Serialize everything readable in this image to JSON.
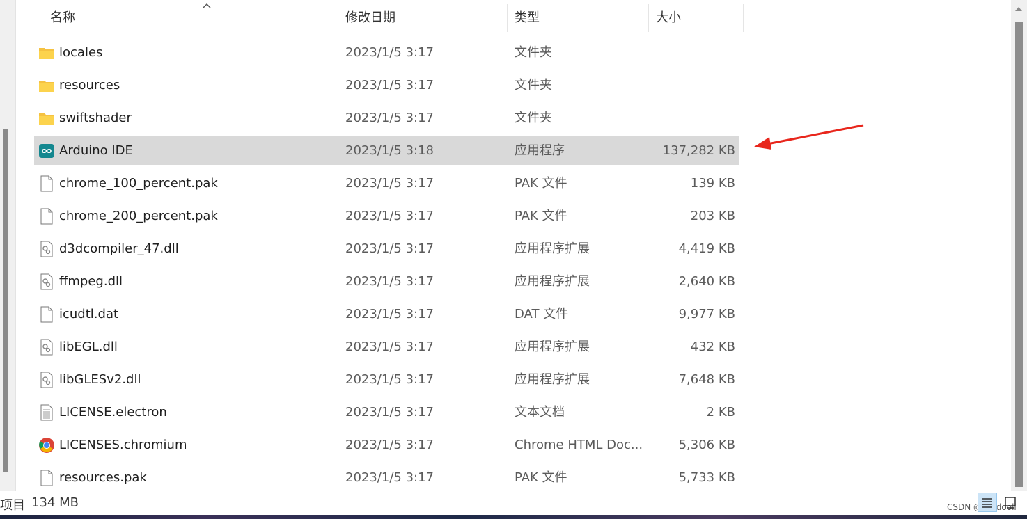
{
  "header": {
    "columns": {
      "name": "名称",
      "date": "修改日期",
      "type": "类型",
      "size": "大小"
    },
    "sort_indicator": "^"
  },
  "files": [
    {
      "icon": "folder-icon",
      "name": "locales",
      "date": "2023/1/5 3:17",
      "type": "文件夹",
      "size": ""
    },
    {
      "icon": "folder-icon",
      "name": "resources",
      "date": "2023/1/5 3:17",
      "type": "文件夹",
      "size": ""
    },
    {
      "icon": "folder-icon",
      "name": "swiftshader",
      "date": "2023/1/5 3:17",
      "type": "文件夹",
      "size": ""
    },
    {
      "icon": "arduino-icon",
      "name": "Arduino IDE",
      "date": "2023/1/5 3:18",
      "type": "应用程序",
      "size": "137,282 KB",
      "selected": true
    },
    {
      "icon": "file-icon",
      "name": "chrome_100_percent.pak",
      "date": "2023/1/5 3:17",
      "type": "PAK 文件",
      "size": "139 KB"
    },
    {
      "icon": "file-icon",
      "name": "chrome_200_percent.pak",
      "date": "2023/1/5 3:17",
      "type": "PAK 文件",
      "size": "203 KB"
    },
    {
      "icon": "dll-icon",
      "name": "d3dcompiler_47.dll",
      "date": "2023/1/5 3:17",
      "type": "应用程序扩展",
      "size": "4,419 KB"
    },
    {
      "icon": "dll-icon",
      "name": "ffmpeg.dll",
      "date": "2023/1/5 3:17",
      "type": "应用程序扩展",
      "size": "2,640 KB"
    },
    {
      "icon": "file-icon",
      "name": "icudtl.dat",
      "date": "2023/1/5 3:17",
      "type": "DAT 文件",
      "size": "9,977 KB"
    },
    {
      "icon": "dll-icon",
      "name": "libEGL.dll",
      "date": "2023/1/5 3:17",
      "type": "应用程序扩展",
      "size": "432 KB"
    },
    {
      "icon": "dll-icon",
      "name": "libGLESv2.dll",
      "date": "2023/1/5 3:17",
      "type": "应用程序扩展",
      "size": "7,648 KB"
    },
    {
      "icon": "text-file-icon",
      "name": "LICENSE.electron",
      "date": "2023/1/5 3:17",
      "type": "文本文档",
      "size": "2 KB"
    },
    {
      "icon": "chrome-icon",
      "name": "LICENSES.chromium",
      "date": "2023/1/5 3:17",
      "type": "Chrome HTML Doc...",
      "size": "5,306 KB"
    },
    {
      "icon": "file-icon",
      "name": "resources.pak",
      "date": "2023/1/5 3:17",
      "type": "PAK 文件",
      "size": "5,733 KB"
    }
  ],
  "status": {
    "item_count": "项目",
    "selected_size": "134 MB"
  },
  "watermark": "CSDN @windooll",
  "colors": {
    "selected_row": "#d9d9d9",
    "annotation_arrow": "#e8261c",
    "folder": "#f7c948",
    "arduino": "#13878f"
  }
}
